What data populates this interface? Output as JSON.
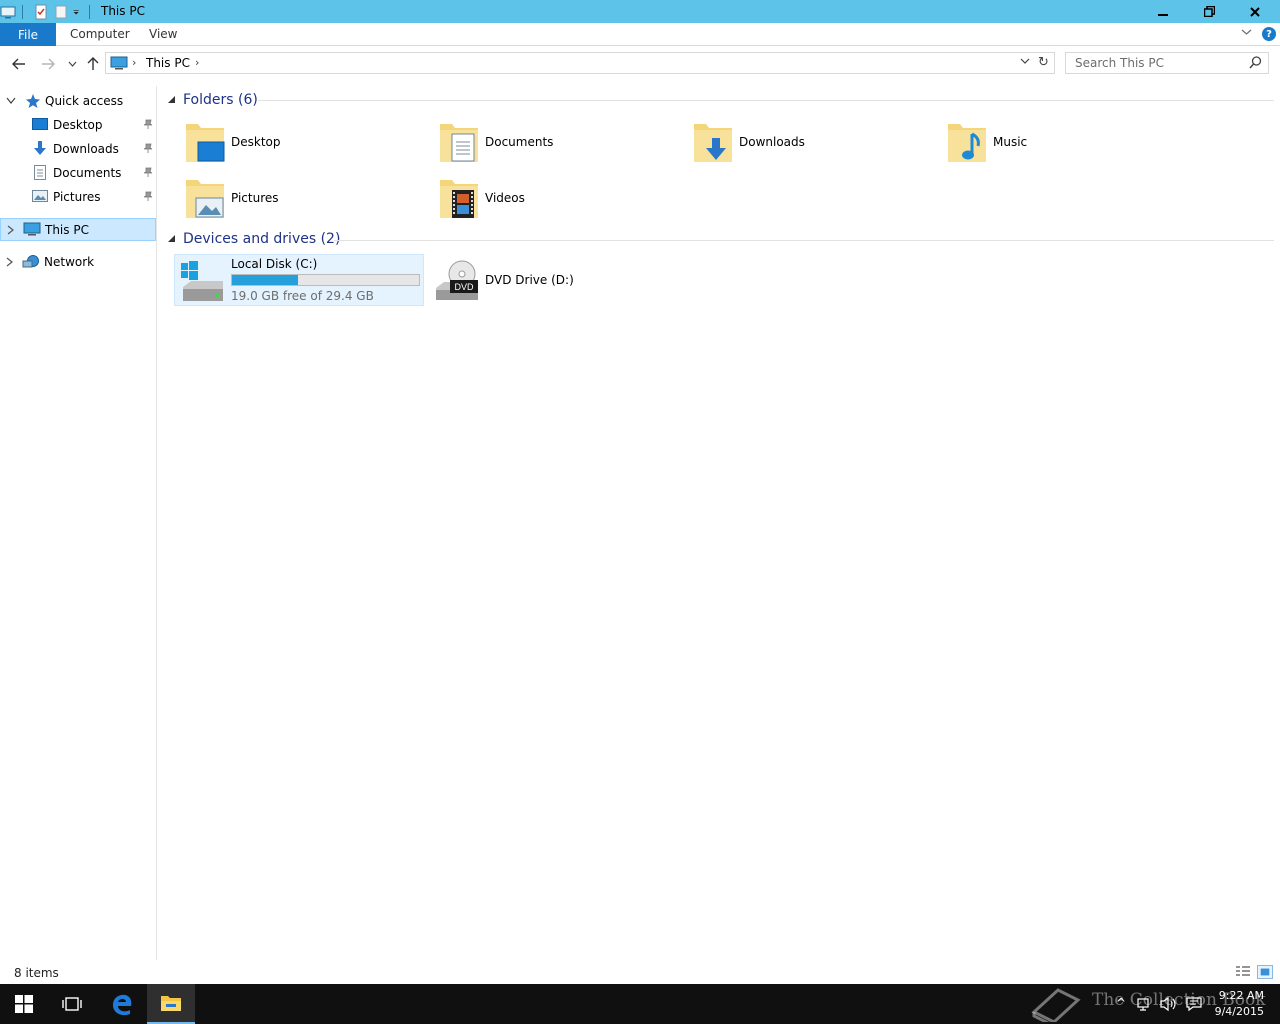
{
  "window": {
    "title": "This PC",
    "buttons": {
      "minimize": "minimize",
      "restore": "restore",
      "close": "close"
    }
  },
  "ribbon": {
    "file": "File",
    "tabs": [
      "Computer",
      "View"
    ],
    "help": "?"
  },
  "nav": {
    "breadcrumb": "This PC",
    "search_placeholder": "Search This PC"
  },
  "sidebar": {
    "quick_access": "Quick access",
    "quick_items": [
      {
        "label": "Desktop",
        "icon": "desktop-icon"
      },
      {
        "label": "Downloads",
        "icon": "downloads-icon"
      },
      {
        "label": "Documents",
        "icon": "documents-icon"
      },
      {
        "label": "Pictures",
        "icon": "pictures-icon"
      }
    ],
    "this_pc": "This PC",
    "network": "Network"
  },
  "content": {
    "folders_header": "Folders (6)",
    "folders": [
      {
        "label": "Desktop",
        "icon": "desktop-folder-icon"
      },
      {
        "label": "Documents",
        "icon": "documents-folder-icon"
      },
      {
        "label": "Downloads",
        "icon": "downloads-folder-icon"
      },
      {
        "label": "Music",
        "icon": "music-folder-icon"
      },
      {
        "label": "Pictures",
        "icon": "pictures-folder-icon"
      },
      {
        "label": "Videos",
        "icon": "videos-folder-icon"
      }
    ],
    "devices_header": "Devices and drives (2)",
    "drives": [
      {
        "label": "Local Disk (C:)",
        "free_text": "19.0 GB free of 29.4 GB",
        "used_fraction": 0.354
      },
      {
        "label": "DVD Drive (D:)",
        "badge": "DVD"
      }
    ]
  },
  "status": {
    "items": "8 items"
  },
  "taskbar": {
    "time": "9:22 AM",
    "date": "9/4/2015",
    "watermark": "The Collection Book"
  },
  "colors": {
    "titlebar": "#5ec3e8",
    "accent": "#1979ca",
    "selection": "#cce8ff",
    "progress": "#26a0da",
    "header_text": "#1e3287"
  }
}
